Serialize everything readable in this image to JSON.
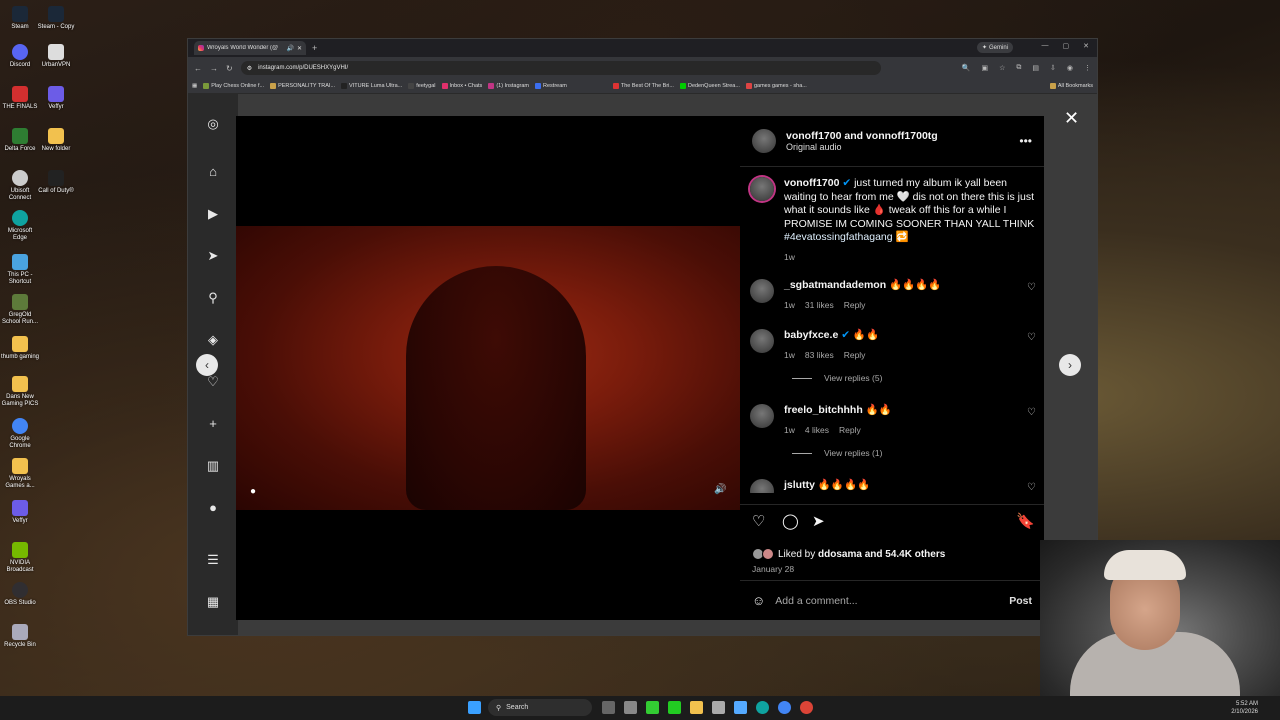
{
  "browser": {
    "tab_title": "Wroyals World Wonder (@",
    "gemini_label": "Gemini",
    "url": "instagram.com/p/DUESHXYgVHI/",
    "bookmarks": [
      "Play Chess Online f...",
      "PERSONALITY TRAI...",
      "VITURE Luma Ultra...",
      "feetygal",
      "Inbox • Chats",
      "(1) Instagram",
      "Restream"
    ],
    "bookmarks_right": [
      "The Best Of The Bri...",
      "DedenQueen Strea...",
      "games games - sha..."
    ],
    "all_bookmarks": "All Bookmarks"
  },
  "post": {
    "header_user": "vonoff1700 and vonnoff1700tg",
    "header_sub": "Original audio",
    "caption_user": "vonoff1700",
    "caption_text": " just turned my album ik yall been waiting to hear from me 🤍 dis not on there this is just what it sounds like 🩸 tweak off this for a while I PROMISE IM COMING SOONER THAN YALL THINK ",
    "caption_tag": "#4evatossingfathagang",
    "caption_emoji": " 🔁",
    "caption_time": "1w",
    "comments": [
      {
        "user": "_sgbatmandademon",
        "text": " 🔥🔥🔥🔥",
        "time": "1w",
        "likes": "31 likes",
        "reply": "Reply"
      },
      {
        "user": "babyfxce.e",
        "text": " 🔥🔥",
        "time": "1w",
        "likes": "83 likes",
        "reply": "Reply",
        "view_replies": "View replies (5)"
      },
      {
        "user": "freelo_bitchhhh",
        "text": " 🔥🔥",
        "time": "1w",
        "likes": "4 likes",
        "reply": "Reply",
        "view_replies": "View replies (1)"
      },
      {
        "user": "jslutty",
        "text": " 🔥🔥🔥🔥"
      }
    ],
    "liked_by_prefix": "Liked by ",
    "liked_by_user": "ddosama",
    "liked_by_suffix": " and 54.4K others",
    "date": "January 28",
    "add_comment_placeholder": "Add a comment...",
    "post_button": "Post"
  },
  "desktop": {
    "icons": [
      "Steam",
      "Steam - Copy",
      "Discord",
      "UrbanVPN",
      "THE FINALS",
      "Veffyr",
      "Delta Force",
      "New folder",
      "Ubisoft Connect",
      "Call of Duty®",
      "Microsoft Edge",
      "This PC - Shortcut",
      "GregOld School Run...",
      "thumb gaming",
      "Dans New Gaming PICS",
      "Google Chrome",
      "Wroyals Games a...",
      "Veffyr",
      "NVIDIA Broadcast",
      "OBS Studio",
      "Recycle Bin"
    ]
  },
  "taskbar": {
    "search_label": "Search",
    "time": "5:52 AM",
    "date": "2/10/2026"
  }
}
